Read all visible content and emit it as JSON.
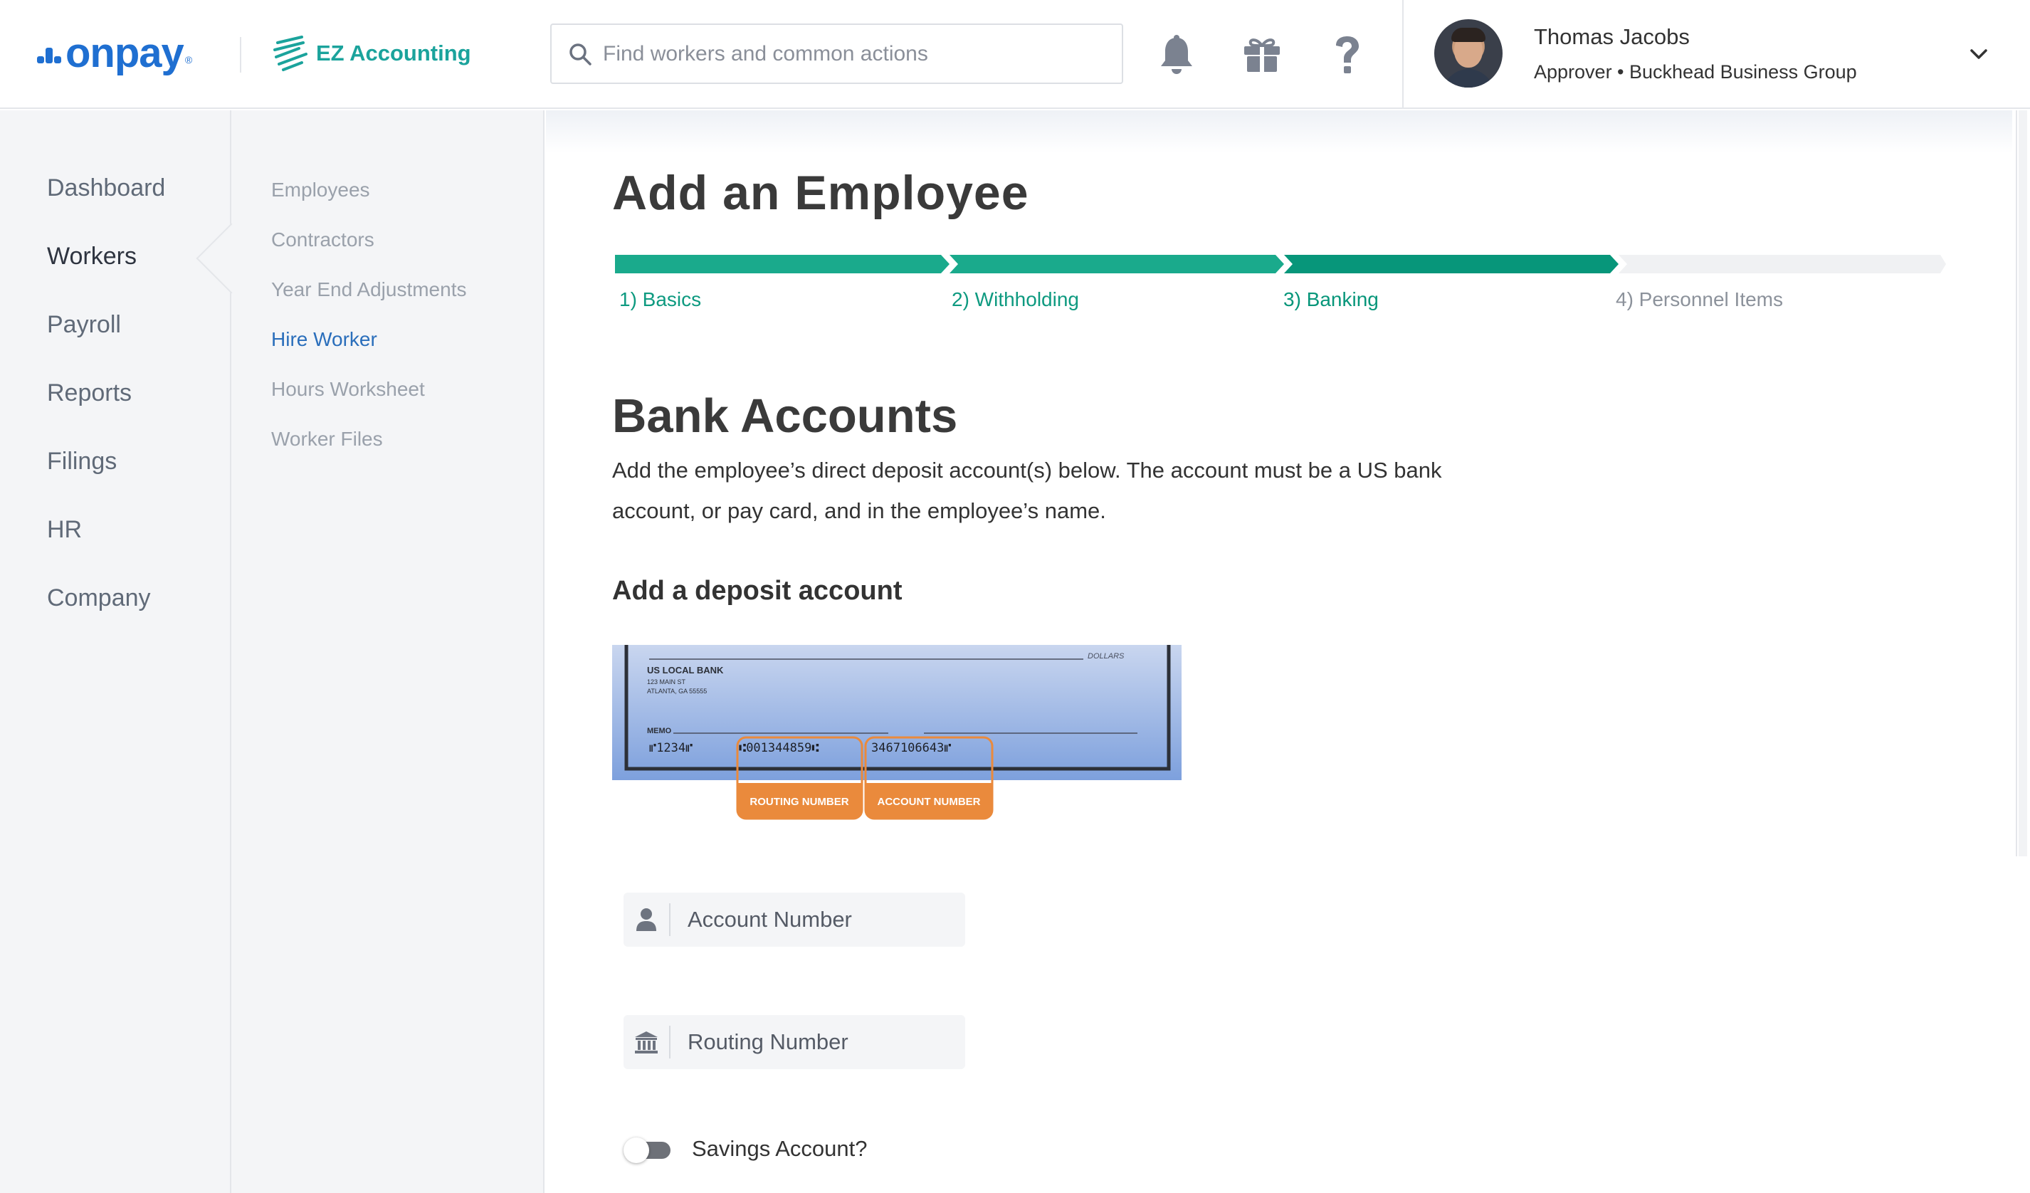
{
  "brand": {
    "logo_text": "onpay",
    "logo_mark": "®",
    "partner_name": "EZ Accounting"
  },
  "search": {
    "placeholder": "Find workers and common actions"
  },
  "header_icons": [
    "bell-icon",
    "gift-icon",
    "help-icon"
  ],
  "user": {
    "name": "Thomas Jacobs",
    "role": "Approver • Buckhead Business Group"
  },
  "nav_primary": [
    {
      "label": "Dashboard",
      "active": false
    },
    {
      "label": "Workers",
      "active": true
    },
    {
      "label": "Payroll",
      "active": false
    },
    {
      "label": "Reports",
      "active": false
    },
    {
      "label": "Filings",
      "active": false
    },
    {
      "label": "HR",
      "active": false
    },
    {
      "label": "Company",
      "active": false
    }
  ],
  "nav_secondary": [
    {
      "label": "Employees",
      "active": false
    },
    {
      "label": "Contractors",
      "active": false
    },
    {
      "label": "Year End Adjustments",
      "active": false
    },
    {
      "label": "Hire Worker",
      "active": true
    },
    {
      "label": "Hours Worksheet",
      "active": false
    },
    {
      "label": "Worker Files",
      "active": false
    }
  ],
  "page": {
    "title": "Add an Employee"
  },
  "steps": [
    {
      "label": "1) Basics",
      "state": "done"
    },
    {
      "label": "2) Withholding",
      "state": "done"
    },
    {
      "label": "3) Banking",
      "state": "current"
    },
    {
      "label": "4) Personnel Items",
      "state": "todo"
    }
  ],
  "section": {
    "title": "Bank Accounts",
    "description": "Add the employee’s direct deposit account(s) below. The account must be a US bank account, or pay card, and in the employee’s name.",
    "subtitle": "Add a deposit account"
  },
  "check": {
    "dollars": "DOLLARS",
    "bank_name": "US LOCAL BANK",
    "address1": "123 MAIN ST",
    "address2": "ATLANTA, GA 55555",
    "memo": "MEMO",
    "micr_check": "⑈1234⑈",
    "micr_routing": "⑆001344859⑆",
    "micr_account": "3467106643⑈",
    "routing_tag": "ROUTING NUMBER",
    "account_tag": "ACCOUNT NUMBER"
  },
  "form": {
    "account_placeholder": "Account Number",
    "routing_placeholder": "Routing Number",
    "savings_label": "Savings Account?",
    "savings_on": false
  },
  "colors": {
    "brand_blue": "#1f6fd1",
    "teal": "#1ba39c",
    "step_done": "#1aaa8c",
    "step_current": "#07967a",
    "step_todo": "#f0f1f3",
    "link_blue": "#2a6ebb",
    "orange": "#ea8a3c"
  }
}
